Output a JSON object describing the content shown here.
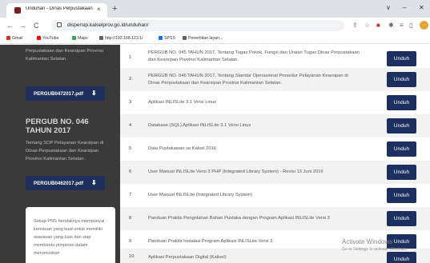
{
  "browser": {
    "tab_title": "Unduhan - Dinas Perpustakaan",
    "tab_close": "×",
    "new_tab": "+",
    "window_min": "∨",
    "window_restore": "–",
    "window_close": "✕",
    "url": "dispersip.kalselprov.go.id/unduhan/",
    "back": "←",
    "forward": "→",
    "reload": "C",
    "home": "⌂"
  },
  "bookmarks": [
    {
      "label": "Gmail",
      "color": "#d93025"
    },
    {
      "label": "YouTube",
      "color": "#ff0000"
    },
    {
      "label": "Maps",
      "color": "#34a853"
    },
    {
      "label": "http://192.168.123.1/",
      "color": "#5f6368"
    },
    {
      "label": "SPSS",
      "color": "#1a73e8"
    },
    {
      "label": "Penerbitan layan...",
      "color": "#5f6368"
    }
  ],
  "sidebar": {
    "text_top": "Perpustakaan dan Kearsipan Provinsi Kalimantan Selatan.",
    "file1": "PERGUB0472017.pdf",
    "title2": "PERGUB NO. 046 TAHUN 2017",
    "text2": "Tentang SOP Pelayanan Kearsipan di Dinas Perpustakaan dan Kearsipan Provinsi Kalimantan Selatan.",
    "file2": "PERGUB0462017.pdf",
    "download_icon": "⬇",
    "card_text": "Setiap PNS hendaknya mempunyai kemauan yang kuat untuk memiliki wawasan yang luas dan siap membantu pimpinan dalam merumuskan"
  },
  "downloads": [
    {
      "no": "1",
      "title": "PERGUB NO. 045 TAHUN 2017, Tentang Tugas Pokok, Fungsi dan Uraian Tugas Dinas Perpustakaan dan Kearsipan Provinsi Kalimantan Selatan.",
      "button": "Unduh"
    },
    {
      "no": "2",
      "title": "PERGUB NO. 046 TAHUN 2017, Tentang Standar Operasional Prosedur Pelayanan Kearsipan di Dinas Perpustakaan dan Kearsipan Provinsi Kalimantan Selatan.",
      "button": "Unduh"
    },
    {
      "no": "3",
      "title": "Aplikasi INLISLite 3.1 Versi Linux",
      "button": "Unduh"
    },
    {
      "no": "4",
      "title": "Database (SQL) Aplikasi INLISLite 3.1 Versi Linux",
      "button": "Unduh"
    },
    {
      "no": "5",
      "title": "Data Pustakawan se Kalsel 2016",
      "button": "Unduh"
    },
    {
      "no": "6",
      "title": "User Manual INLISLite Versi 3 PHP (Integrated Library System) - Revisi 13 Juni 2016",
      "button": "Unduh"
    },
    {
      "no": "7",
      "title": "User Manual INLISLite (Integrated Library System)",
      "button": "Unduh"
    },
    {
      "no": "8",
      "title": "Panduan Praktis Pengolahan Bahan Pustaka dengan Program Aplikasi INLISLite Versi 3",
      "button": "Unduh"
    },
    {
      "no": "9",
      "title": "Panduan Praktis Instalasi Program Aplikasi INLISLite Versi 3",
      "button": "Unduh"
    },
    {
      "no": "10",
      "title": "Aplikasi Perpustakaan Digital (Kalisel)",
      "button": "Unduh"
    }
  ],
  "watermark": {
    "line1": "Activate Windows",
    "line2": "Go to Settings to activate Windows."
  }
}
